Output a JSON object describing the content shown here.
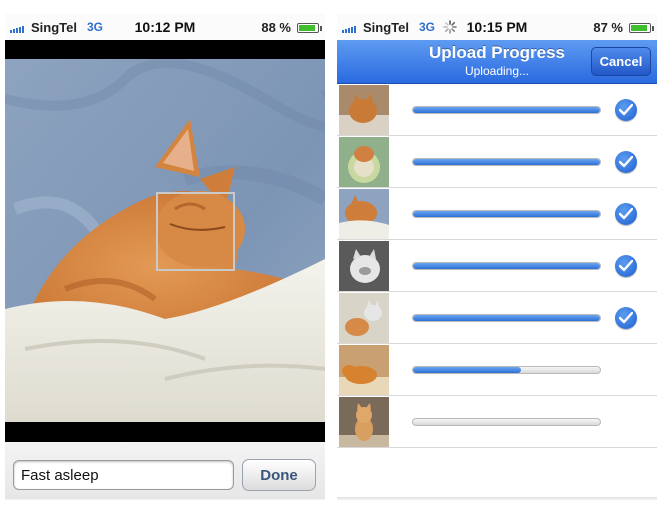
{
  "left_screen": {
    "status": {
      "carrier": "SingTel",
      "network": "3G",
      "time": "10:12 PM",
      "battery": "88 %"
    },
    "caption": {
      "value": "Fast asleep"
    },
    "done_label": "Done"
  },
  "right_screen": {
    "status": {
      "carrier": "SingTel",
      "network": "3G",
      "time": "10:15 PM",
      "battery": "87 %"
    },
    "nav": {
      "title": "Upload Progress",
      "subtitle": "Uploading...",
      "cancel_label": "Cancel"
    },
    "uploads": [
      {
        "progress": 1.0,
        "complete": true
      },
      {
        "progress": 1.0,
        "complete": true
      },
      {
        "progress": 1.0,
        "complete": true
      },
      {
        "progress": 1.0,
        "complete": true
      },
      {
        "progress": 1.0,
        "complete": true
      },
      {
        "progress": 0.58,
        "complete": false
      },
      {
        "progress": 0.0,
        "complete": false
      }
    ]
  },
  "colors": {
    "accent": "#2f6fd1",
    "nav_bar": "#3b7be6",
    "check": "#2a6ad8",
    "progress": "#3b7be6"
  }
}
